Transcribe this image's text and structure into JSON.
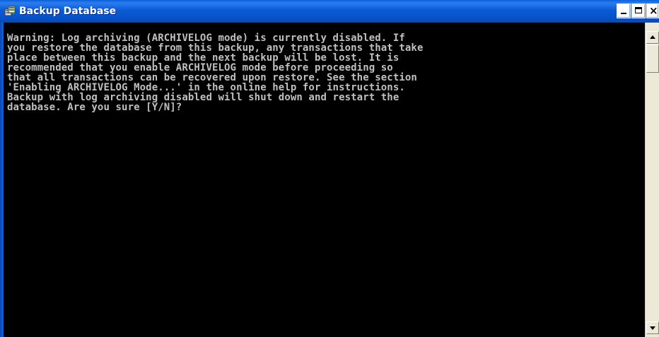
{
  "window": {
    "title": "Backup Database",
    "icon": "database-backup-icon",
    "controls": {
      "minimize": "minimize-icon",
      "maximize": "maximize-icon",
      "close": "close-icon",
      "close_glyph": "×"
    }
  },
  "console": {
    "text": "Warning: Log archiving (ARCHIVELOG mode) is currently disabled. If\nyou restore the database from this backup, any transactions that take\nplace between this backup and the next backup will be lost. It is\nrecommended that you enable ARCHIVELOG mode before proceeding so\nthat all transactions can be recovered upon restore. See the section\n'Enabling ARCHIVELOG Mode...' in the online help for instructions.\nBackup with log archiving disabled will shut down and restart the\ndatabase. Are you sure [Y/N]?",
    "background": "#000000",
    "foreground": "#c0c0c0"
  },
  "scrollbar": {
    "up": "scroll-up-arrow-icon",
    "down": "scroll-down-arrow-icon"
  },
  "colors": {
    "titlebar": "#0b5bd6",
    "title_text": "#ffffff",
    "scrollbar": "#ece9d8"
  }
}
